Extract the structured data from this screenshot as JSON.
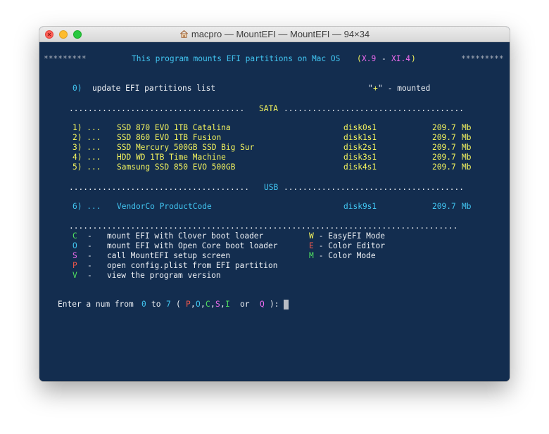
{
  "window": {
    "title": "macpro — MountEFI — MountEFI — 94×34"
  },
  "header": {
    "stars_left": "*********",
    "text": "This program mounts EFI partitions on Mac OS",
    "paren_open": "(",
    "ver_from": "X.9",
    "dash": "-",
    "ver_to": "XI.4",
    "paren_close": ")",
    "stars_right": "*********"
  },
  "update_item": {
    "key": "0)",
    "label": "update EFI partitions list",
    "legend_quote_open": "\"",
    "legend_plus": "+",
    "legend_quote_close": "\"",
    "legend_text": " - mounted"
  },
  "sata_section": {
    "dots_left": ".....................................",
    "label": "SATA",
    "dots_right": "......................................"
  },
  "sata_drives": [
    {
      "num": "1) ...",
      "name": "SSD 870 EVO 1TB Catalina",
      "disk": "disk0s1",
      "size": "209.7",
      "unit": "Mb"
    },
    {
      "num": "2) ...",
      "name": "SSD 860 EVO 1TB Fusion",
      "disk": "disk1s1",
      "size": "209.7",
      "unit": "Mb"
    },
    {
      "num": "3) ...",
      "name": "SSD Mercury 500GB SSD Big Sur",
      "disk": "disk2s1",
      "size": "209.7",
      "unit": "Mb"
    },
    {
      "num": "4) ...",
      "name": "HDD WD 1TB Time Machine",
      "disk": "disk3s1",
      "size": "209.7",
      "unit": "Mb"
    },
    {
      "num": "5) ...",
      "name": "Samsung SSD 850 EVO 500GB",
      "disk": "disk4s1",
      "size": "209.7",
      "unit": "Mb"
    }
  ],
  "usb_section": {
    "dots_left": "......................................",
    "label": "USB",
    "dots_right": "......................................"
  },
  "usb_drives": [
    {
      "num": "6) ...",
      "name": "VendorCo ProductCode",
      "disk": "disk9s1",
      "size": "209.7",
      "unit": "Mb"
    }
  ],
  "divider": "..................................................................................",
  "commands_left": [
    {
      "key": "C",
      "sep": "-",
      "label": "mount EFI with Clover boot loader"
    },
    {
      "key": "O",
      "sep": "-",
      "label": "mount EFI with Open Core boot loader"
    },
    {
      "key": "S",
      "sep": "-",
      "label": "call MountEFI setup screen"
    },
    {
      "key": "P",
      "sep": "-",
      "label": "open config.plist from EFI partition"
    },
    {
      "key": "V",
      "sep": "-",
      "label": "view the program version"
    }
  ],
  "commands_right": [
    {
      "key": "W",
      "label": " - EasyEFI Mode"
    },
    {
      "key": "E",
      "label": " - Color Editor"
    },
    {
      "key": "M",
      "label": " - Color Mode"
    }
  ],
  "prompt": {
    "text": "Enter a num from",
    "from": "0",
    "to_word": "to",
    "to": "7",
    "paren_open": "(",
    "k1": "P",
    "comma1": ",",
    "k2": "O",
    "comma2": ",",
    "k3": "C",
    "comma3": ",",
    "k4": "S",
    "comma4": ",",
    "k5": "I",
    "or_word": "or",
    "k6": "Q",
    "close": "):"
  },
  "colors": {
    "terminal_bg": "#132d4f",
    "yellow": "#f4f45e",
    "cyan": "#42c6f2",
    "magenta": "#f06bf0",
    "green": "#50e060",
    "red": "#f0584c"
  }
}
